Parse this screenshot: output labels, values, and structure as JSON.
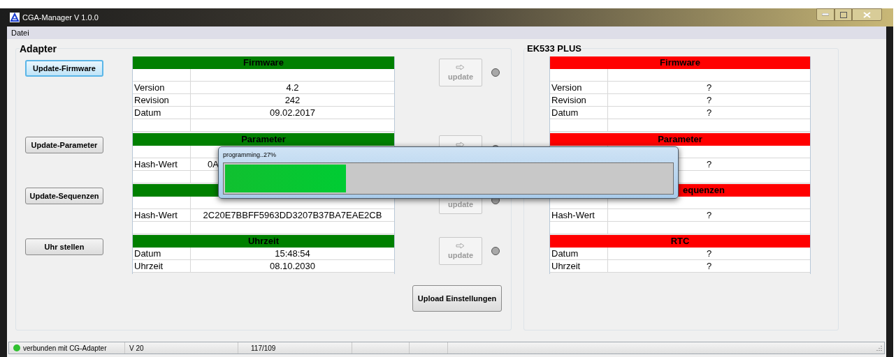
{
  "window": {
    "title": "CGA-Manager V 1.0.0"
  },
  "menu": [
    {
      "label": "Datei"
    }
  ],
  "adapter": {
    "title": "Adapter",
    "sections": [
      {
        "button": {
          "label": "Update-Firmware",
          "focused": true
        },
        "header": {
          "title": "Firmware",
          "color": "#008000"
        },
        "rows": [
          {
            "kind": "blank"
          },
          {
            "kind": "data",
            "label": "Version",
            "value": "4.2"
          },
          {
            "kind": "data",
            "label": "Revision",
            "value": "242"
          },
          {
            "kind": "data",
            "label": "Datum",
            "value": "09.02.2017"
          },
          {
            "kind": "blank"
          }
        ],
        "update": {
          "label": "update",
          "arrow": true
        }
      },
      {
        "button": {
          "label": "Update-Parameter",
          "focused": false
        },
        "header": {
          "title": "Parameter",
          "color": "#008000"
        },
        "rows": [
          {
            "kind": "blank"
          },
          {
            "kind": "data",
            "label": "Hash-Wert",
            "value": "0A",
            "partial": true
          },
          {
            "kind": "blank"
          }
        ],
        "update": {
          "arrow": true
        }
      },
      {
        "button": {
          "label": "Update-Sequenzen",
          "focused": false
        },
        "header": {
          "color": "#008000"
        },
        "rows": [
          {
            "kind": "blank"
          },
          {
            "kind": "data",
            "label": "Hash-Wert",
            "value": "2C20E7BBFF5963DD3207B37BA7EAE2CB"
          },
          {
            "kind": "blank"
          }
        ],
        "update": {
          "label": "update"
        }
      },
      {
        "button": {
          "label": "Uhr stellen",
          "focused": false
        },
        "header": {
          "title": "Uhrzeit",
          "color": "#008000"
        },
        "rows": [
          {
            "kind": "data",
            "label": "Datum",
            "value": "15:48:54"
          },
          {
            "kind": "data",
            "label": "Uhrzeit",
            "value": "08.10.2030"
          }
        ],
        "update": {
          "label": "update",
          "arrow": true
        }
      }
    ],
    "upload_button": "Upload Einstellungen"
  },
  "device": {
    "title": "EK533 PLUS",
    "sections": [
      {
        "header": {
          "title": "Firmware",
          "color": "#ff0000"
        },
        "rows": [
          {
            "kind": "blank"
          },
          {
            "kind": "data",
            "label": "Version",
            "value": "?"
          },
          {
            "kind": "data",
            "label": "Revision",
            "value": "?"
          },
          {
            "kind": "data",
            "label": "Datum",
            "value": "?"
          },
          {
            "kind": "blank"
          }
        ]
      },
      {
        "header": {
          "title": "Parameter",
          "color": "#ff0000"
        },
        "rows": [
          {
            "kind": "blank"
          },
          {
            "kind": "data",
            "value": "?"
          },
          {
            "kind": "blank"
          }
        ]
      },
      {
        "header": {
          "title": "equenzen",
          "color": "#ff0000",
          "partial": true
        },
        "rows": [
          {
            "kind": "blank"
          },
          {
            "kind": "data",
            "label": "Hash-Wert",
            "value": "?"
          },
          {
            "kind": "blank"
          }
        ]
      },
      {
        "header": {
          "title": "RTC",
          "color": "#ff0000"
        },
        "rows": [
          {
            "kind": "data",
            "label": "Datum",
            "value": "?"
          },
          {
            "kind": "data",
            "label": "Uhrzeit",
            "value": "?"
          }
        ]
      }
    ]
  },
  "progress_dialog": {
    "title": "programming..27%",
    "level": 0.27
  },
  "status_bar": {
    "connected": true,
    "connection": "verbunden mit CG-Adapter",
    "version": "V 20",
    "count": "117/109"
  }
}
